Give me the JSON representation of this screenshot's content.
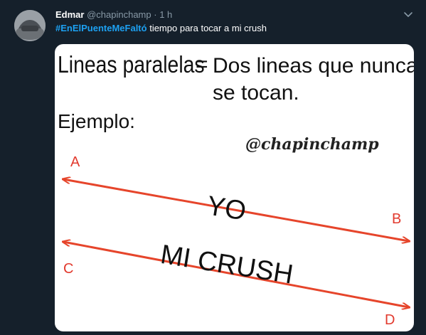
{
  "tweet": {
    "author_name": "Edmar",
    "author_handle": "@chapinchamp",
    "separator": "·",
    "time": "1 h",
    "hashtag": "#EnElPuenteMeFaltó",
    "text": "tiempo para tocar a mi crush"
  },
  "image": {
    "title_left": "Lineas paralelas",
    "equals": "=",
    "definition_line1": "Dos lineas que nunca",
    "definition_line2": "se tocan.",
    "example_label": "Ejemplo:",
    "watermark": "@chapinchamp",
    "label_a": "A",
    "label_b": "B",
    "label_c": "C",
    "label_d": "D",
    "line1_label": "YO",
    "line2_label": "MI CRUSH"
  },
  "colors": {
    "background": "#15202b",
    "hashtag": "#1da1f2",
    "secondary_text": "#8899a6",
    "arrow": "#e6452b",
    "letters": "#e23a2e"
  },
  "icons": {
    "more": "chevron-down-icon",
    "avatar": "avatar"
  }
}
